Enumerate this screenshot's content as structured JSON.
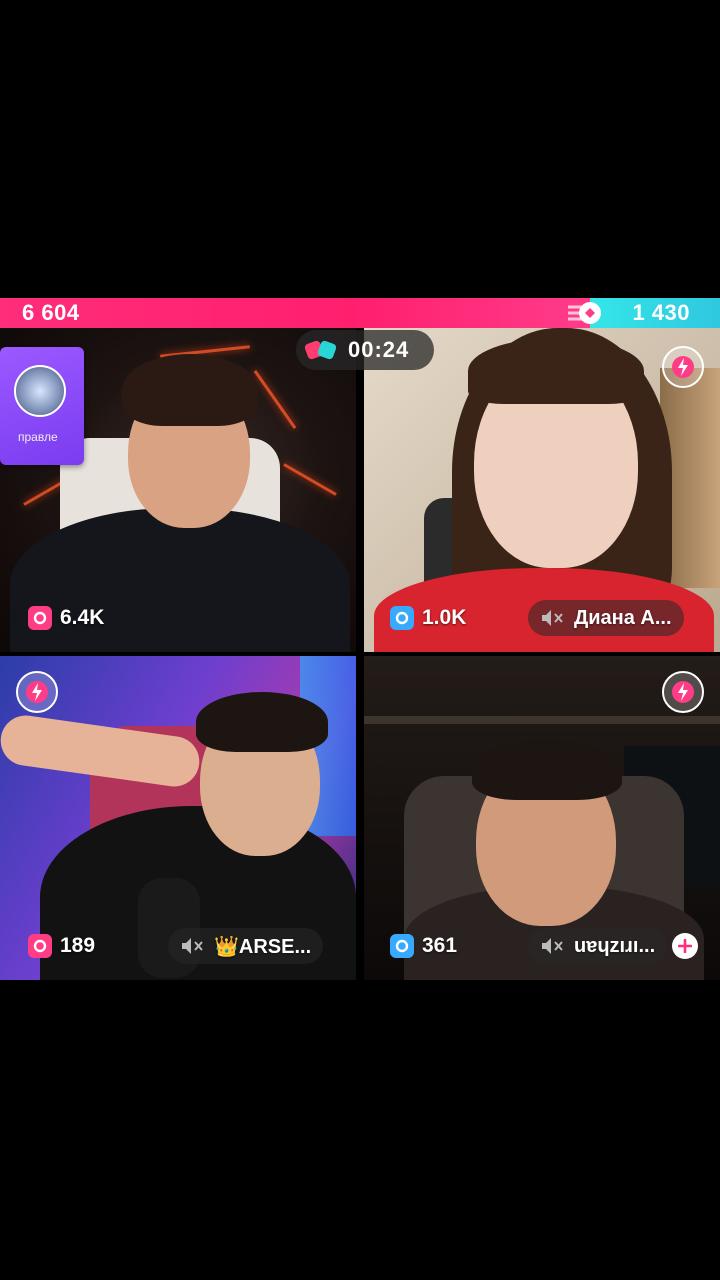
{
  "battle": {
    "left_score": "6 604",
    "right_score": "1 430",
    "left_ratio": 0.82,
    "colors": {
      "left": "#ff1f6e",
      "right": "#35e6e8"
    }
  },
  "timer": {
    "value": "00:24",
    "icon": "battle-gloves-icon"
  },
  "gift_card": {
    "text": "правле"
  },
  "participants": [
    {
      "score": "6.4K",
      "badge_color": "pink",
      "name": ""
    },
    {
      "score": "1.0K",
      "badge_color": "blue",
      "name": "Диана А..."
    },
    {
      "score": "189",
      "badge_color": "pink",
      "name": "👑ARSE..."
    },
    {
      "score": "361",
      "badge_color": "blue",
      "name": "uɐɥzıɹı..."
    }
  ]
}
